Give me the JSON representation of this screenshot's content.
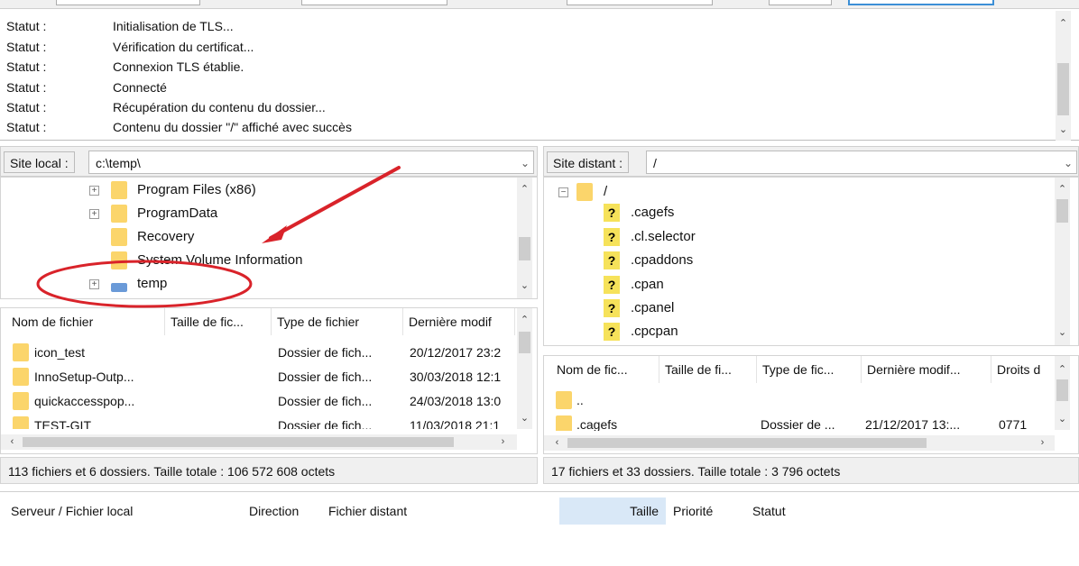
{
  "log": {
    "lines": [
      {
        "key": "Statut :",
        "value": "Initialisation de TLS..."
      },
      {
        "key": "Statut :",
        "value": "Vérification du certificat..."
      },
      {
        "key": "Statut :",
        "value": "Connexion TLS établie."
      },
      {
        "key": "Statut :",
        "value": "Connecté"
      },
      {
        "key": "Statut :",
        "value": "Récupération du contenu du dossier..."
      },
      {
        "key": "Statut :",
        "value": "Contenu du dossier \"/\" affiché avec succès"
      }
    ]
  },
  "local": {
    "site_label": "Site local :",
    "path": "c:\\temp\\",
    "tree": [
      {
        "name": "Program Files (x86)",
        "expandable": true
      },
      {
        "name": "ProgramData",
        "expandable": true
      },
      {
        "name": "Recovery",
        "expandable": false
      },
      {
        "name": "System Volume Information",
        "expandable": false
      },
      {
        "name": "temp",
        "expandable": true,
        "selected": true
      }
    ],
    "columns": [
      "Nom de fichier",
      "Taille de fic...",
      "Type de fichier",
      "Dernière modif"
    ],
    "files": [
      {
        "name": "icon_test",
        "size": "",
        "type": "Dossier de fich...",
        "modified": "20/12/2017 23:2"
      },
      {
        "name": "InnoSetup-Outp...",
        "size": "",
        "type": "Dossier de fich...",
        "modified": "30/03/2018 12:1"
      },
      {
        "name": "quickaccesspop...",
        "size": "",
        "type": "Dossier de fich...",
        "modified": "24/03/2018 13:0"
      },
      {
        "name": "TEST-GIT",
        "size": "",
        "type": "Dossier de fich...",
        "modified": "11/03/2018 21:1"
      }
    ],
    "status": "113 fichiers et 6 dossiers. Taille totale : 106 572 608 octets"
  },
  "remote": {
    "site_label": "Site distant :",
    "path": "/",
    "tree": [
      {
        "name": "/",
        "root": true
      },
      {
        "name": ".cagefs"
      },
      {
        "name": ".cl.selector"
      },
      {
        "name": ".cpaddons"
      },
      {
        "name": ".cpan"
      },
      {
        "name": ".cpanel"
      },
      {
        "name": ".cpcpan"
      }
    ],
    "columns": [
      "Nom de fic...",
      "Taille de fi...",
      "Type de fic...",
      "Dernière modif...",
      "Droits d"
    ],
    "files": [
      {
        "name": "..",
        "size": "",
        "type": "",
        "modified": "",
        "perms": ""
      },
      {
        "name": ".cagefs",
        "size": "",
        "type": "Dossier de ...",
        "modified": "21/12/2017 13:...",
        "perms": "0771"
      }
    ],
    "status": "17 fichiers et 33 dossiers. Taille totale : 3 796 octets"
  },
  "queue": {
    "columns": {
      "server": "Serveur / Fichier local",
      "direction": "Direction",
      "remote": "Fichier distant",
      "size": "Taille",
      "priority": "Priorité",
      "status": "Statut"
    }
  },
  "colors": {
    "annotation": "#d9232a",
    "folder": "#fbd56b",
    "unknown_icon": "#f6e25a",
    "selected_header": "#d9e8f7"
  },
  "icons": {
    "expand": "plus-square-icon",
    "collapse": "minus-square-icon",
    "folder": "folder-icon",
    "unknown": "question-mark-icon",
    "dropdown": "chevron-down-icon"
  }
}
